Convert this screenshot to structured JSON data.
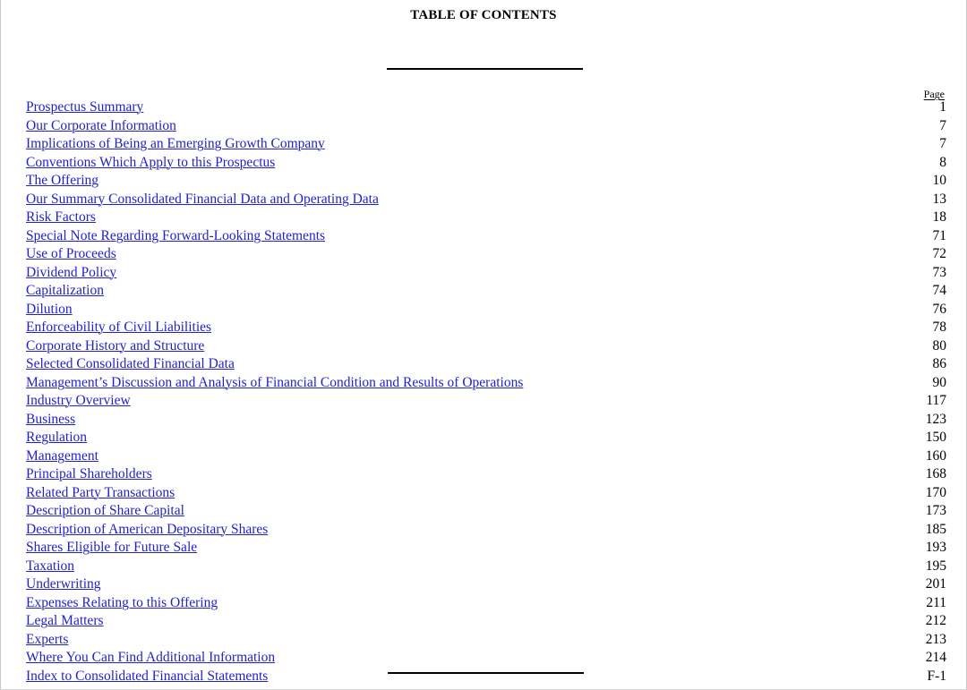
{
  "document": {
    "title": "TABLE OF CONTENTS",
    "page_column_header": "Page",
    "link_color": "#2222CC",
    "text_color": "#000000"
  },
  "toc": {
    "entries": [
      {
        "label": "Prospectus Summary",
        "page": "1"
      },
      {
        "label": "Our Corporate Information",
        "page": "7"
      },
      {
        "label": "Implications of Being an Emerging Growth Company",
        "page": "7"
      },
      {
        "label": "Conventions Which Apply to this Prospectus",
        "page": "8"
      },
      {
        "label": "The Offering",
        "page": "10"
      },
      {
        "label": "Our Summary Consolidated Financial Data and Operating Data",
        "page": "13"
      },
      {
        "label": "Risk Factors",
        "page": "18"
      },
      {
        "label": "Special Note Regarding Forward-Looking Statements",
        "page": "71"
      },
      {
        "label": "Use of Proceeds",
        "page": "72"
      },
      {
        "label": "Dividend Policy",
        "page": "73"
      },
      {
        "label": "Capitalization",
        "page": "74"
      },
      {
        "label": "Dilution",
        "page": "76"
      },
      {
        "label": "Enforceability of Civil Liabilities",
        "page": "78"
      },
      {
        "label": "Corporate History and Structure",
        "page": "80"
      },
      {
        "label": "Selected Consolidated Financial Data",
        "page": "86"
      },
      {
        "label": "Management’s Discussion and Analysis of Financial Condition and Results of Operations",
        "page": "90"
      },
      {
        "label": "Industry Overview",
        "page": "117"
      },
      {
        "label": "Business",
        "page": "123"
      },
      {
        "label": "Regulation",
        "page": "150"
      },
      {
        "label": "Management",
        "page": "160"
      },
      {
        "label": "Principal Shareholders",
        "page": "168"
      },
      {
        "label": "Related Party Transactions",
        "page": "170"
      },
      {
        "label": "Description of Share Capital",
        "page": "173"
      },
      {
        "label": "Description of American Depositary Shares",
        "page": "185"
      },
      {
        "label": "Shares Eligible for Future Sale",
        "page": "193"
      },
      {
        "label": "Taxation",
        "page": "195"
      },
      {
        "label": "Underwriting",
        "page": "201"
      },
      {
        "label": "Expenses Relating to this Offering",
        "page": "211"
      },
      {
        "label": "Legal Matters",
        "page": "212"
      },
      {
        "label": "Experts",
        "page": "213"
      },
      {
        "label": "Where You Can Find Additional Information",
        "page": "214"
      },
      {
        "label": "Index to Consolidated Financial Statements",
        "page": "F-1"
      }
    ]
  }
}
